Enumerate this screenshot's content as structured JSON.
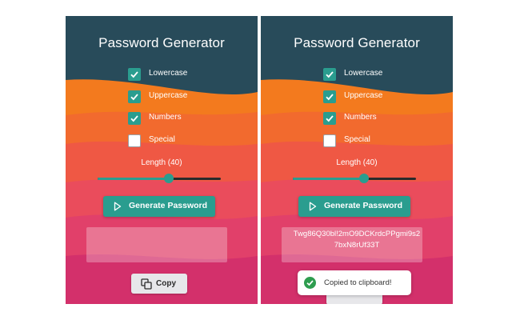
{
  "colors": {
    "header": "#284b5a",
    "accent": "#2a9d8f",
    "success": "#2e9d4f"
  },
  "left": {
    "title": "Password Generator",
    "options": [
      {
        "label": "Lowercase",
        "checked": true
      },
      {
        "label": "Uppercase",
        "checked": true
      },
      {
        "label": "Numbers",
        "checked": true
      },
      {
        "label": "Special",
        "checked": false
      }
    ],
    "length_label": "Length (40)",
    "length_fraction": 0.58,
    "generate_label": "Generate Password",
    "password": "",
    "copy_label": "Copy"
  },
  "right": {
    "title": "Password Generator",
    "options": [
      {
        "label": "Lowercase",
        "checked": true
      },
      {
        "label": "Uppercase",
        "checked": true
      },
      {
        "label": "Numbers",
        "checked": true
      },
      {
        "label": "Special",
        "checked": false
      }
    ],
    "length_label": "Length (40)",
    "length_fraction": 0.58,
    "generate_label": "Generate Password",
    "password_line1": "Twg86Q30bl!2mO9DCKrdcPPgmi9s2",
    "password_line2": "7bxN8rUf33T",
    "toast": "Copied to clipboard!"
  }
}
